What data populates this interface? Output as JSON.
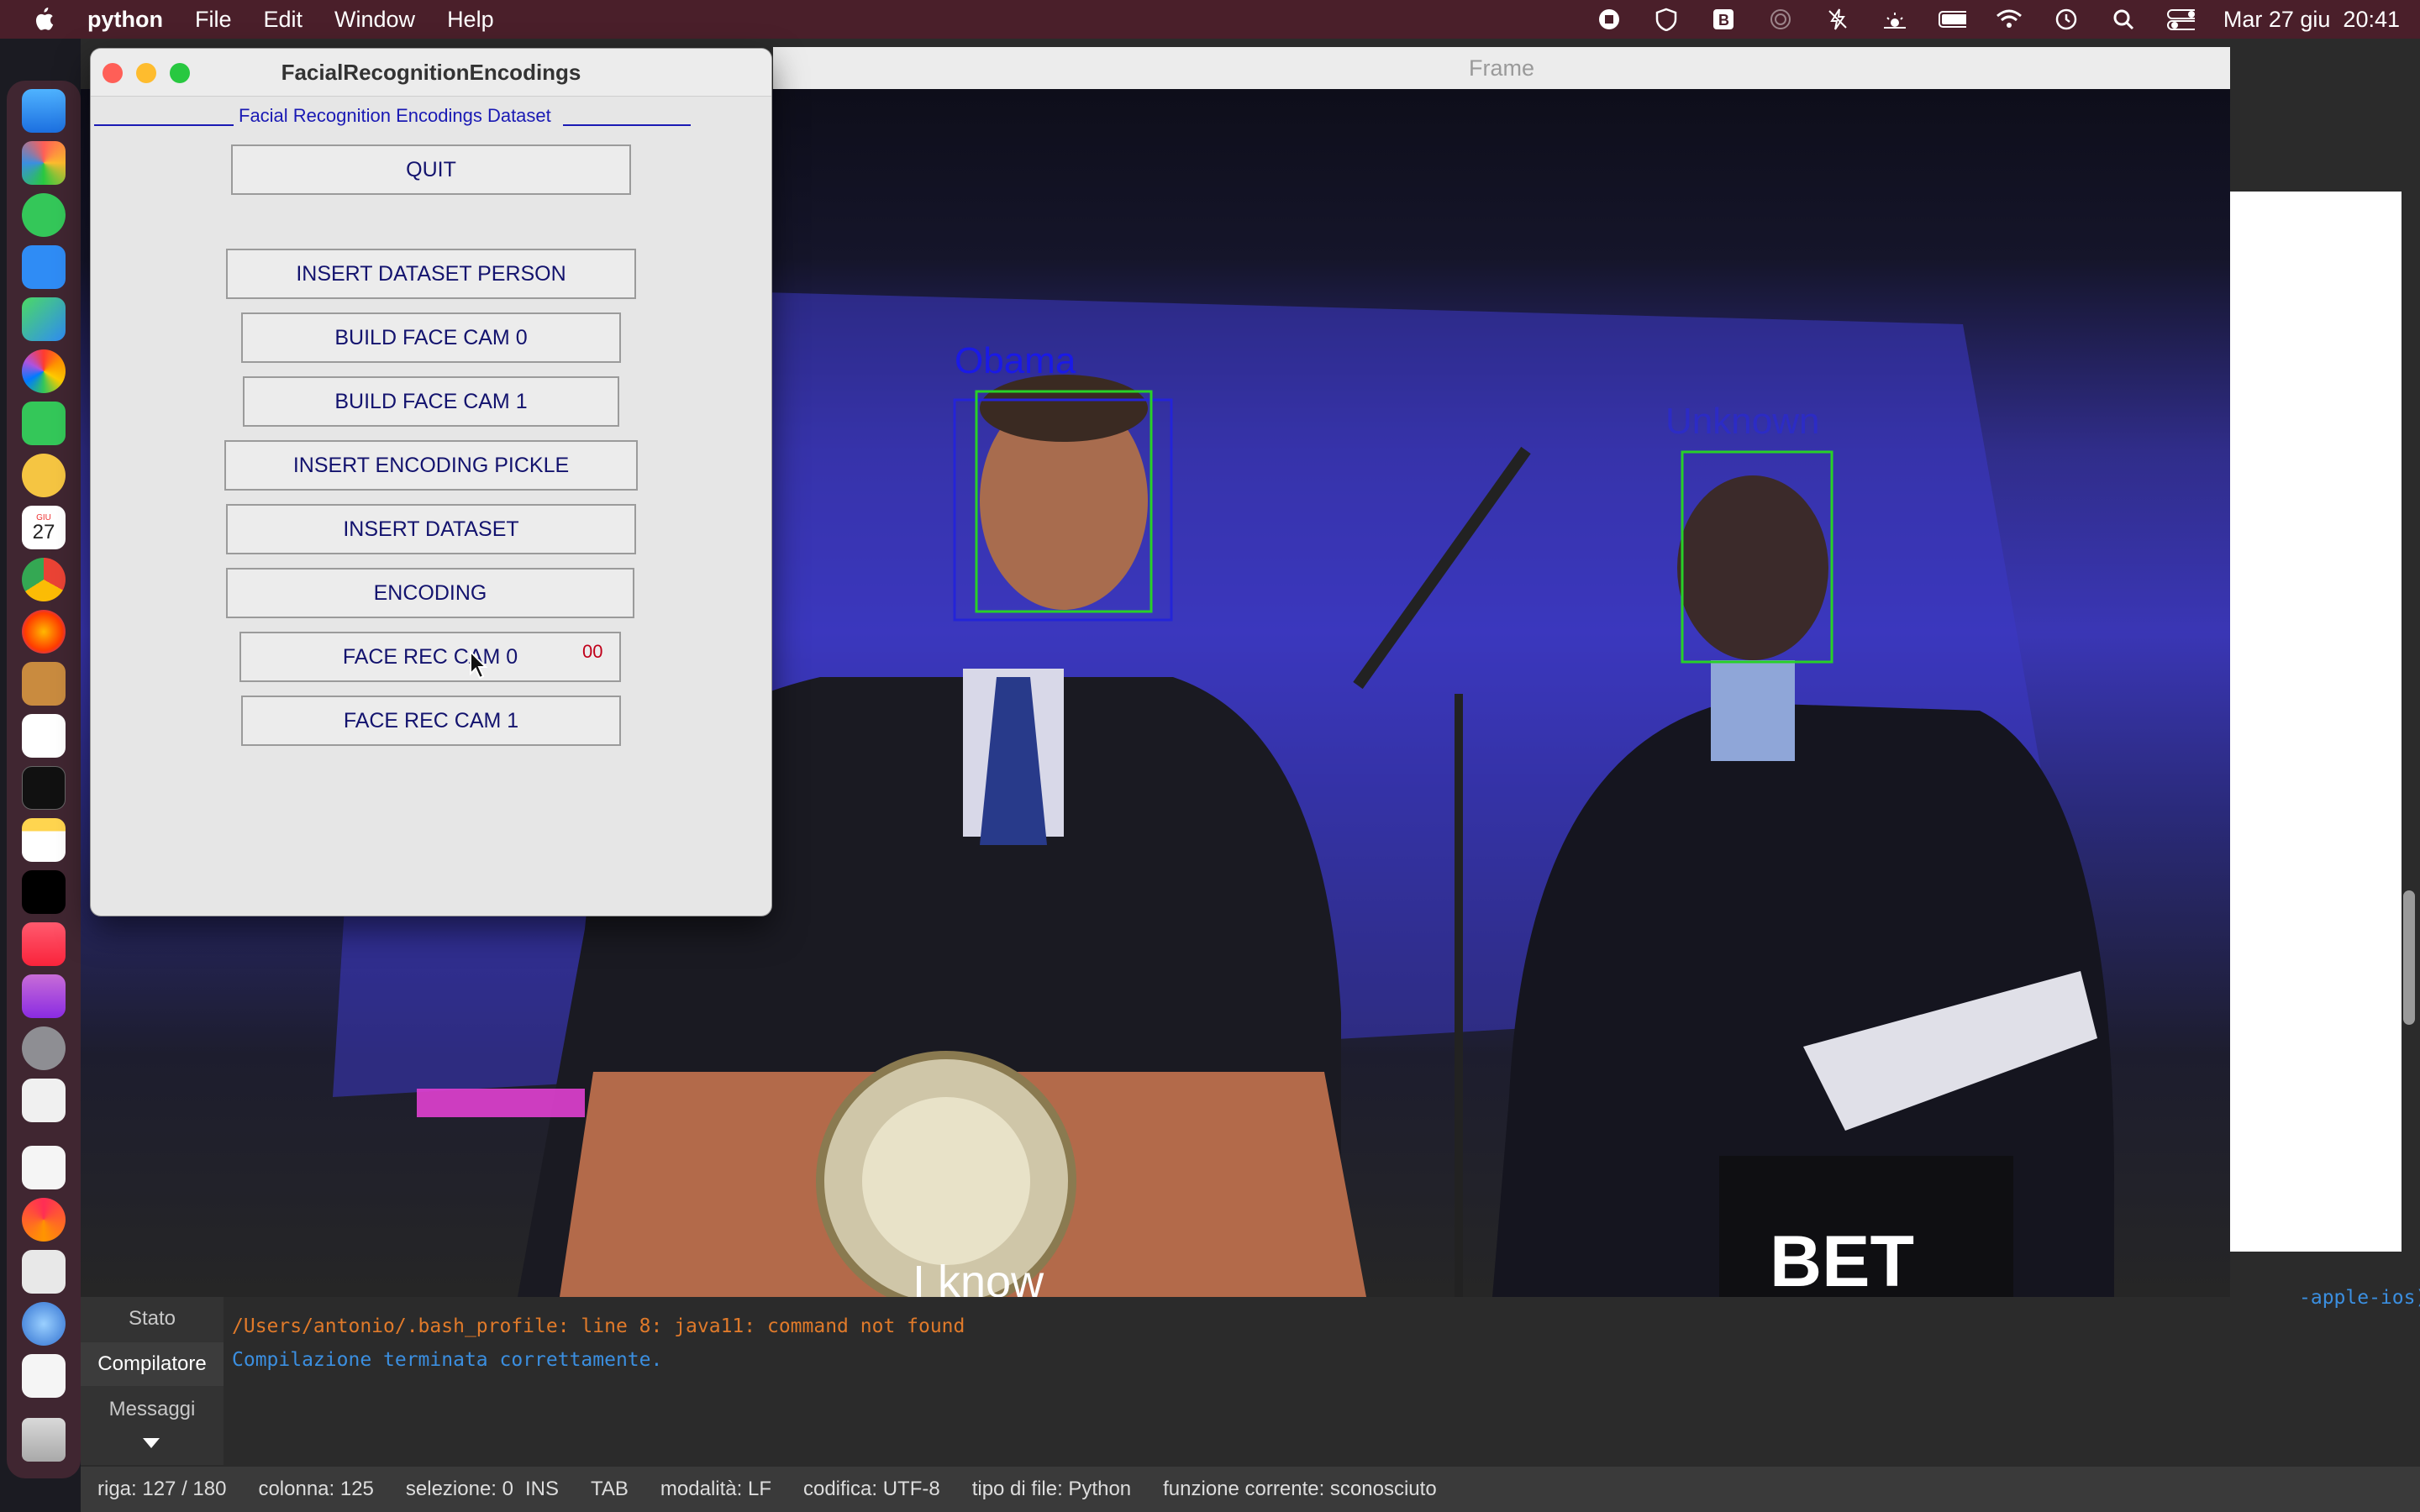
{
  "menubar": {
    "app_name": "python",
    "items": [
      "File",
      "Edit",
      "Window",
      "Help"
    ],
    "datetime": "Mar 27 giu  20:41"
  },
  "dock": {
    "calendar_day": "27",
    "calendar_month": "GIU"
  },
  "frame_window": {
    "title": "Frame",
    "faces": [
      {
        "label": "Obama",
        "color": "#1a1ae6"
      },
      {
        "label": "Unknown",
        "color": "#1a1ae6"
      }
    ],
    "bottom_text": "I know",
    "logo_text": "BET"
  },
  "tk_window": {
    "title": "FacialRecognitionEncodings",
    "header": "Facial Recognition Encodings Dataset",
    "buttons": {
      "quit": "QUIT",
      "insert_dataset_person": "INSERT DATASET PERSON",
      "build_face_cam_0": "BUILD FACE CAM 0",
      "build_face_cam_1": "BUILD FACE CAM 1",
      "insert_encoding_pickle": "INSERT ENCODING PICKLE",
      "insert_dataset": "INSERT DATASET",
      "encoding": "ENCODING",
      "face_rec_cam_0": "FACE REC CAM 0",
      "face_rec_cam_1": "FACE REC CAM 1"
    },
    "counter": "00"
  },
  "console": {
    "tabs": [
      "Stato",
      "Compilatore",
      "Messaggi"
    ],
    "active_tab": "Compilatore",
    "lines": [
      {
        "text": "/Users/antonio/.bash_profile: line 8: java11: command not found",
        "color": "#e07a2a"
      },
      {
        "text": "Compilazione terminata correttamente.",
        "color": "#3b8fe0"
      }
    ],
    "partial_line": "-apple-ios)"
  },
  "statusbar": {
    "riga": "riga: 127 / 180",
    "colonna": "colonna: 125",
    "selezione": "selezione: 0",
    "ins": "INS",
    "tab": "TAB",
    "modalita": "modalità: LF",
    "codifica": "codifica: UTF-8",
    "tipo_file": "tipo di file: Python",
    "funzione": "funzione corrente: sconosciuto"
  }
}
